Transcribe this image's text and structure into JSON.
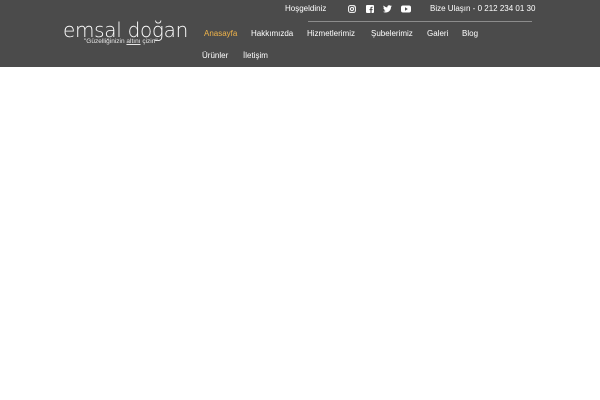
{
  "logo": {
    "title": "emsal doğan",
    "tagline_pre": "\"Güzelliğinizin ",
    "tagline_hl": "altını",
    "tagline_post": " çizin\""
  },
  "topbar": {
    "welcome": "Hoşgeldiniz",
    "contact": "Bize Ulaşın - 0 212 234 01 30",
    "social_icons": [
      "instagram-icon",
      "facebook-icon",
      "twitter-icon",
      "youtube-icon"
    ]
  },
  "nav": {
    "items": [
      {
        "label": "Anasayfa",
        "active": true
      },
      {
        "label": "Hakkımızda",
        "active": false
      },
      {
        "label": "Hizmetlerimiz",
        "active": false
      },
      {
        "label": "Şubelerimiz",
        "active": false
      },
      {
        "label": "Galeri",
        "active": false
      },
      {
        "label": "Blog",
        "active": false
      },
      {
        "label": "Ürünler",
        "active": false
      },
      {
        "label": "İletişim",
        "active": false
      }
    ]
  },
  "colors": {
    "header_bg": "#4b4b4b",
    "accent": "#f0b44a",
    "text": "#ffffff"
  }
}
